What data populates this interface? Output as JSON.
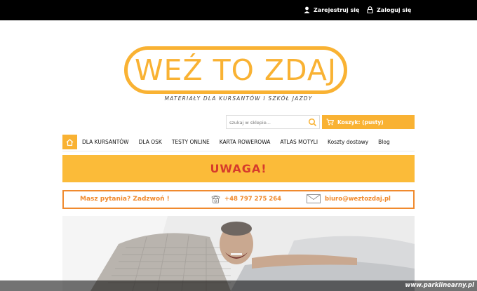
{
  "header": {
    "register_label": "Zarejestruj się",
    "login_label": "Zaloguj się"
  },
  "logo": {
    "text": "WEŹ TO ZDAJ",
    "tagline": "MATERIAŁY DLA KURSANTÓW I SZKÓŁ JAZDY"
  },
  "search": {
    "placeholder": "szukaj w sklepie..."
  },
  "cart": {
    "label": "Koszyk: (pusty)"
  },
  "nav": {
    "items": [
      {
        "label": "DLA KURSANTÓW"
      },
      {
        "label": "DLA OSK"
      },
      {
        "label": "TESTY ONLINE"
      },
      {
        "label": "KARTA ROWEROWA"
      },
      {
        "label": "ATLAS MOTYLI"
      },
      {
        "label": "Koszty dostawy"
      },
      {
        "label": "Blog"
      }
    ]
  },
  "alert": {
    "title": "UWAGA!"
  },
  "contact": {
    "question": "Masz pytania? Zadzwoń !",
    "phone": "+48 797 275 264",
    "email": "biuro@weztozdaj.pl"
  },
  "watermark": "www.parklinearny.pl",
  "colors": {
    "brand": "#f9b233",
    "alert_bg": "#fbbb39",
    "alert_text": "#d63b2c",
    "contact": "#f08a2e"
  }
}
